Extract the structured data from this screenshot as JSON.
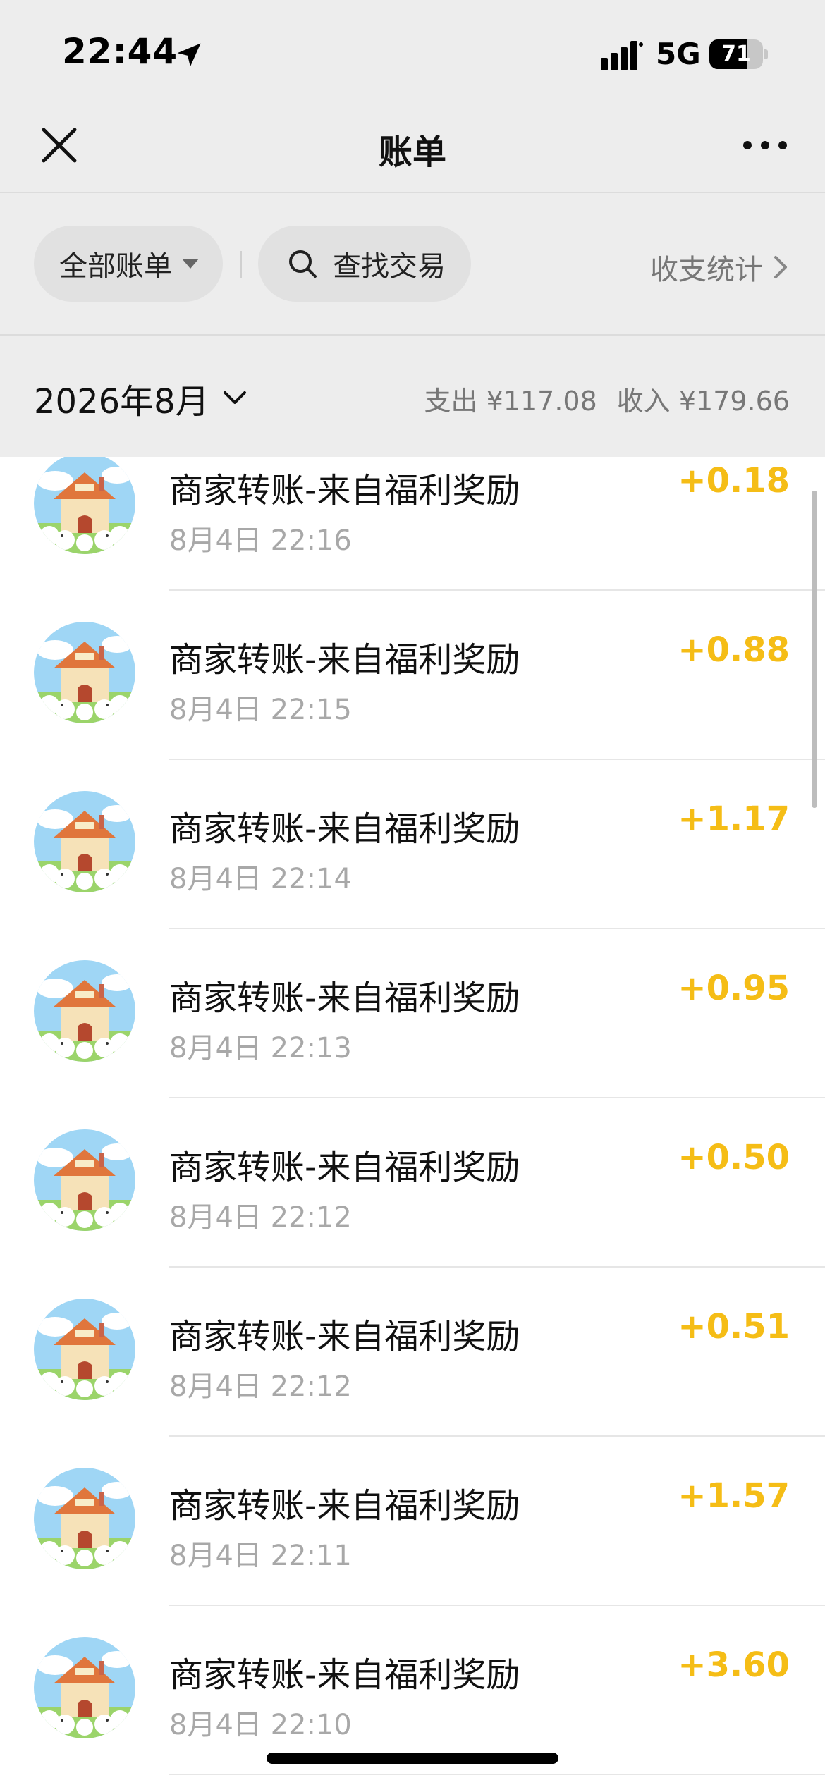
{
  "status_bar": {
    "time": "22:44",
    "network": "5G",
    "battery_text": "71",
    "battery_level_percent": 71,
    "location_icon": "location-arrow-icon",
    "signal_icon": "signal-bars-icon",
    "battery_icon": "battery-icon"
  },
  "nav": {
    "title": "账单",
    "close_icon": "close-icon",
    "more_icon": "more-dots-icon"
  },
  "filter": {
    "all_bills_label": "全部账单",
    "search_label": "查找交易",
    "stats_label": "收支统计"
  },
  "month_summary": {
    "month_label": "2026年8月",
    "expense_label": "支出 ¥117.08",
    "income_label": "收入 ¥179.66"
  },
  "colors": {
    "header_bg": "#ededed",
    "income_amount": "#f5bd16",
    "secondary_text": "#a8a8a8"
  },
  "transactions": [
    {
      "title": "商家转账-来自福利奖励",
      "time": "8月4日 22:16",
      "amount": "+0.18"
    },
    {
      "title": "商家转账-来自福利奖励",
      "time": "8月4日 22:15",
      "amount": "+0.88"
    },
    {
      "title": "商家转账-来自福利奖励",
      "time": "8月4日 22:14",
      "amount": "+1.17"
    },
    {
      "title": "商家转账-来自福利奖励",
      "time": "8月4日 22:13",
      "amount": "+0.95"
    },
    {
      "title": "商家转账-来自福利奖励",
      "time": "8月4日 22:12",
      "amount": "+0.50"
    },
    {
      "title": "商家转账-来自福利奖励",
      "time": "8月4日 22:12",
      "amount": "+0.51"
    },
    {
      "title": "商家转账-来自福利奖励",
      "time": "8月4日 22:11",
      "amount": "+1.57"
    },
    {
      "title": "商家转账-来自福利奖励",
      "time": "8月4日 22:10",
      "amount": "+3.60"
    }
  ]
}
